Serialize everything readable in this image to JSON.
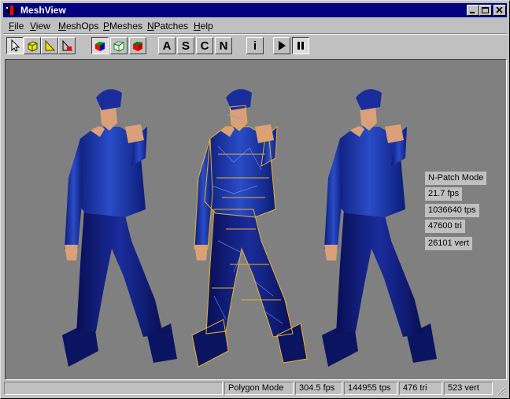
{
  "window": {
    "title": "MeshView",
    "controls": [
      "minimize",
      "maximize",
      "close"
    ]
  },
  "menu": [
    {
      "pre": "",
      "ul": "F",
      "post": "ile"
    },
    {
      "pre": "",
      "ul": "V",
      "post": "iew"
    },
    {
      "pre": "",
      "ul": "M",
      "post": "eshOps"
    },
    {
      "pre": "",
      "ul": "P",
      "post": "Meshes"
    },
    {
      "pre": "",
      "ul": "N",
      "post": "Patches"
    },
    {
      "pre": "",
      "ul": "H",
      "post": "elp"
    }
  ],
  "toolbar": {
    "tools": [
      {
        "icon": "arrow-select-icon",
        "pressed": true
      },
      {
        "icon": "yellow-cube-icon",
        "pressed": false
      },
      {
        "icon": "yellow-triangle-icon",
        "pressed": false
      },
      {
        "icon": "red-triangle-icon",
        "pressed": false
      }
    ],
    "render_modes": [
      {
        "icon": "solid-cube-icon",
        "pressed": true
      },
      {
        "icon": "wireframe-cube-icon",
        "pressed": false
      },
      {
        "icon": "red-cube-icon",
        "pressed": false
      }
    ],
    "letters": [
      "A",
      "S",
      "C",
      "N"
    ],
    "info": "i",
    "playback": [
      {
        "icon": "play-icon",
        "pressed": false
      },
      {
        "icon": "pause-icon",
        "pressed": true
      }
    ]
  },
  "viewport": {
    "background": "#808080",
    "figures": [
      "character-left-flat",
      "character-center-wireframe",
      "character-right-npatch"
    ],
    "colors": {
      "shirt": "#1a2f9a",
      "pants": "#0c1878",
      "skin": "#d9a07a",
      "wire": "#e8b030"
    }
  },
  "npatch_info": {
    "mode": "N-Patch Mode",
    "fps": "21.7 fps",
    "tps": "1036640 tps",
    "tri": "47600 tri",
    "vert": "26101 vert"
  },
  "status": {
    "blank": "",
    "mode": "Polygon Mode",
    "fps": "304.5 fps",
    "tps": "144955 tps",
    "tri": "476 tri",
    "vert": "523 vert"
  }
}
